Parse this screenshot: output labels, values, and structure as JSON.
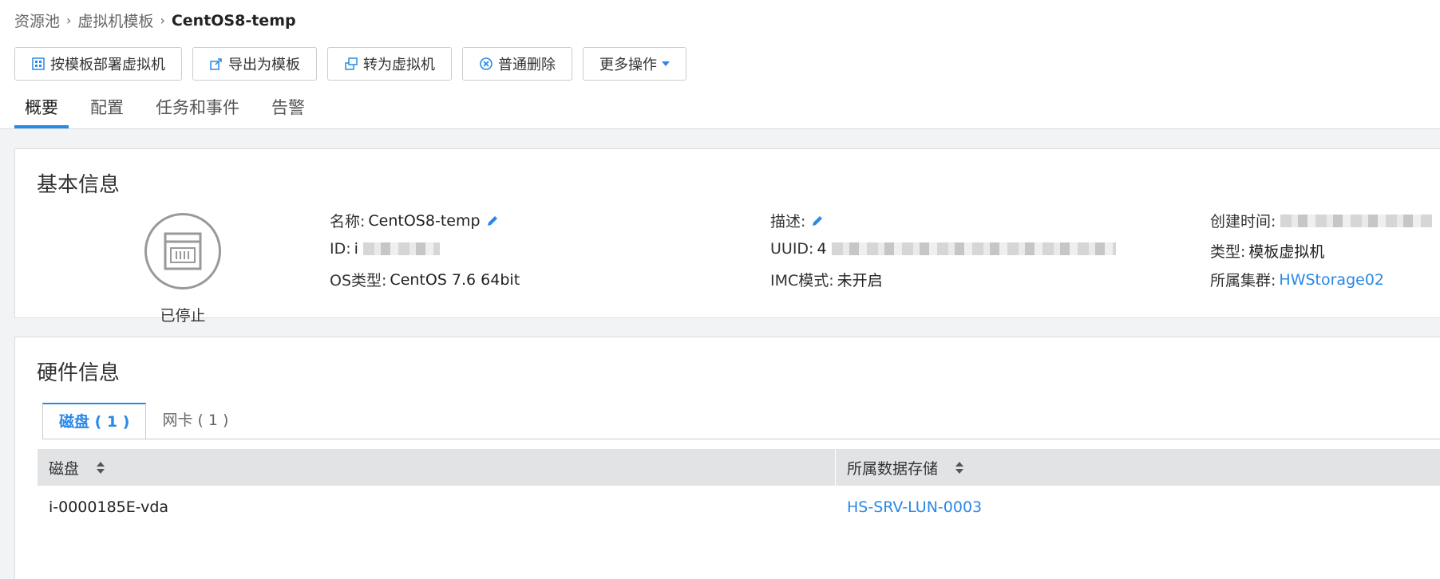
{
  "breadcrumb": {
    "items": [
      "资源池",
      "虚拟机模板"
    ],
    "current": "CentOS8-temp"
  },
  "toolbar": {
    "deploy": "按模板部署虚拟机",
    "export": "导出为模板",
    "convert": "转为虚拟机",
    "delete": "普通删除",
    "more": "更多操作"
  },
  "tabs": [
    "概要",
    "配置",
    "任务和事件",
    "告警"
  ],
  "basic": {
    "title": "基本信息",
    "status": "已停止",
    "name_label": "名称:",
    "name_value": "CentOS8-temp",
    "id_label": "ID:",
    "id_value": "i",
    "os_label": "OS类型:",
    "os_value": "CentOS 7.6 64bit",
    "desc_label": "描述:",
    "uuid_label": "UUID:",
    "uuid_value": "4",
    "imc_label": "IMC模式:",
    "imc_value": "未开启",
    "created_label": "创建时间:",
    "type_label": "类型:",
    "type_value": "模板虚拟机",
    "cluster_label": "所属集群:",
    "cluster_value": "HWStorage02"
  },
  "hardware": {
    "title": "硬件信息",
    "subtabs": [
      "磁盘 ( 1 )",
      "网卡 ( 1 )"
    ],
    "columns": [
      "磁盘",
      "所属数据存储"
    ],
    "rows": [
      {
        "disk": "i-0000185E-vda",
        "storage": "HS-SRV-LUN-0003"
      }
    ]
  },
  "colors": {
    "accent": "#2a88e6",
    "header_bg": "#e1e3e5",
    "page_bg": "#f2f3f4"
  }
}
